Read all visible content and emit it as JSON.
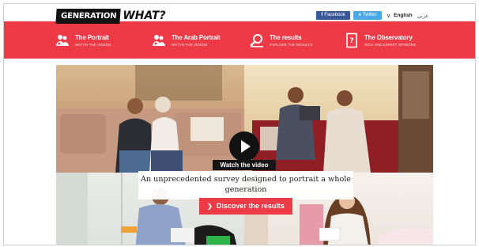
{
  "brand": {
    "logo_box": "GENERATION",
    "logo_what": "WHAT?"
  },
  "header": {
    "facebook_label": "Facebook",
    "twitter_label": "Twitter",
    "language_selected": "English",
    "language_other": "عربي"
  },
  "nav": {
    "items": [
      {
        "title": "The Portrait",
        "subtitle": "Watch the videos",
        "icon": "people-icon"
      },
      {
        "title": "The Arab Portrait",
        "subtitle": "Watch the videos",
        "icon": "people-icon"
      },
      {
        "title": "The results",
        "subtitle": "Explore the results",
        "icon": "magnifier-icon"
      },
      {
        "title": "The Observatory",
        "subtitle": "Rich and expert opinions",
        "icon": "document-icon"
      }
    ]
  },
  "hero": {
    "watch_label": "Watch the video",
    "tagline": "An unprecedented survey designed to portrait a whole generation",
    "discover_label": "Discover the results"
  },
  "colors": {
    "brand_red": "#ee3a46",
    "facebook": "#3b5998",
    "twitter": "#4aa8e8"
  }
}
